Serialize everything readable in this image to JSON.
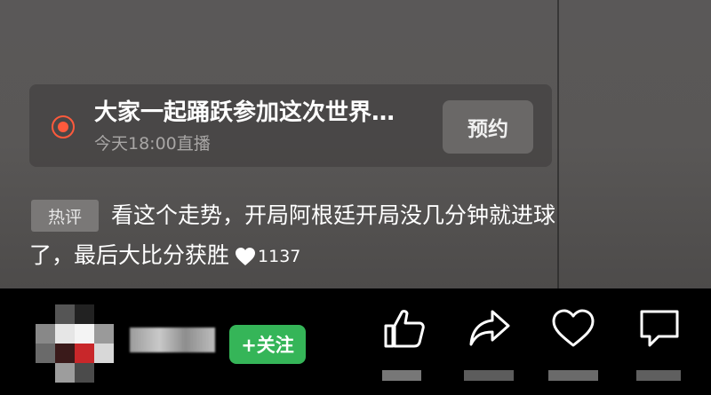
{
  "live_reminder": {
    "title": "大家一起踊跃参加这次世界…",
    "time": "今天18:00直播",
    "reserve_label": "预约"
  },
  "hot_comment": {
    "tag": "热评",
    "line1": "看这个走势，开局阿根廷开局没几分钟就进球",
    "line2": "了，最后大比分获胜",
    "likes": "1137"
  },
  "author": {
    "follow_label": "+关注"
  },
  "actions": [
    {
      "icon": "thumbs-up-icon"
    },
    {
      "icon": "share-icon"
    },
    {
      "icon": "heart-icon"
    },
    {
      "icon": "comment-icon"
    }
  ],
  "colors": {
    "follow_green": "#35b558",
    "live_dot": "#ff5a3c"
  }
}
